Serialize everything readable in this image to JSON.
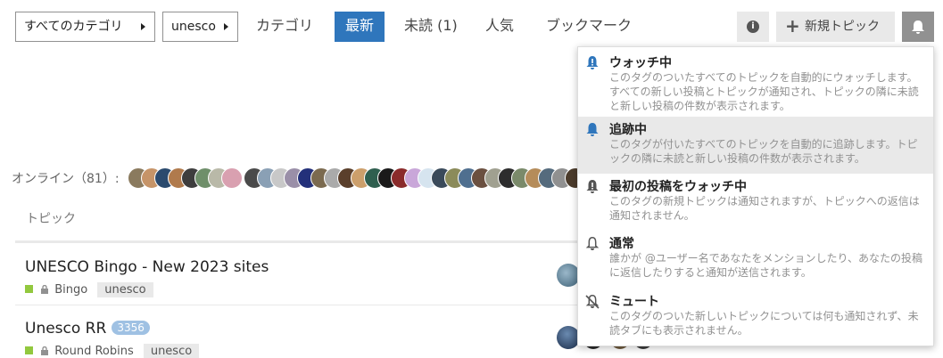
{
  "nav": {
    "category_dropdown": "すべてのカテゴリ",
    "tag_dropdown": "unesco",
    "links": [
      "カテゴリ",
      "最新",
      "未読 (1)",
      "人気",
      "ブックマーク"
    ],
    "active_link": "最新",
    "new_topic_label": "新規トピック"
  },
  "online": {
    "label": "オンライン（81）:",
    "count": 81
  },
  "list": {
    "column_header": "トピック",
    "topics": [
      {
        "title": "UNESCO Bingo - New 2023 sites",
        "category": "Bingo",
        "tag": "unesco",
        "count": ""
      },
      {
        "title": "Unesco RR",
        "count": "3356",
        "category": "Round Robins",
        "tag": "unesco"
      }
    ]
  },
  "notification_menu": {
    "items": [
      {
        "title": "ウォッチ中",
        "desc": "このタグのついたすべてのトピックを自動的にウォッチします。すべての新しい投稿とトピックが通知され、トピックの隣に未読と新しい投稿の件数が表示されます。",
        "icon": "bell-exclamation-icon"
      },
      {
        "title": "追跡中",
        "desc": "このタグが付いたすべてのトピックを自動的に追跡します。トピックの隣に未読と新しい投稿の件数が表示されます。",
        "icon": "bell-icon"
      },
      {
        "title": "最初の投稿をウォッチ中",
        "desc": "このタグの新規トピックは通知されますが、トピックへの返信は通知されません。",
        "icon": "bell-exclamation-icon"
      },
      {
        "title": "通常",
        "desc": "誰かが @ユーザー名であなたをメンションしたり、あなたの投稿に返信したりすると通知が送信されます。",
        "icon": "bell-outline-icon"
      },
      {
        "title": "ミュート",
        "desc": "このタグのついた新しいトピックについては何も通知されず、未読タブにも表示されません。",
        "icon": "bell-slash-icon"
      }
    ]
  },
  "colors": {
    "accent": "#2f76bc",
    "category": "#92c83e",
    "count_badge": "#9fc1e3",
    "highlight": "#e9e9e9"
  }
}
